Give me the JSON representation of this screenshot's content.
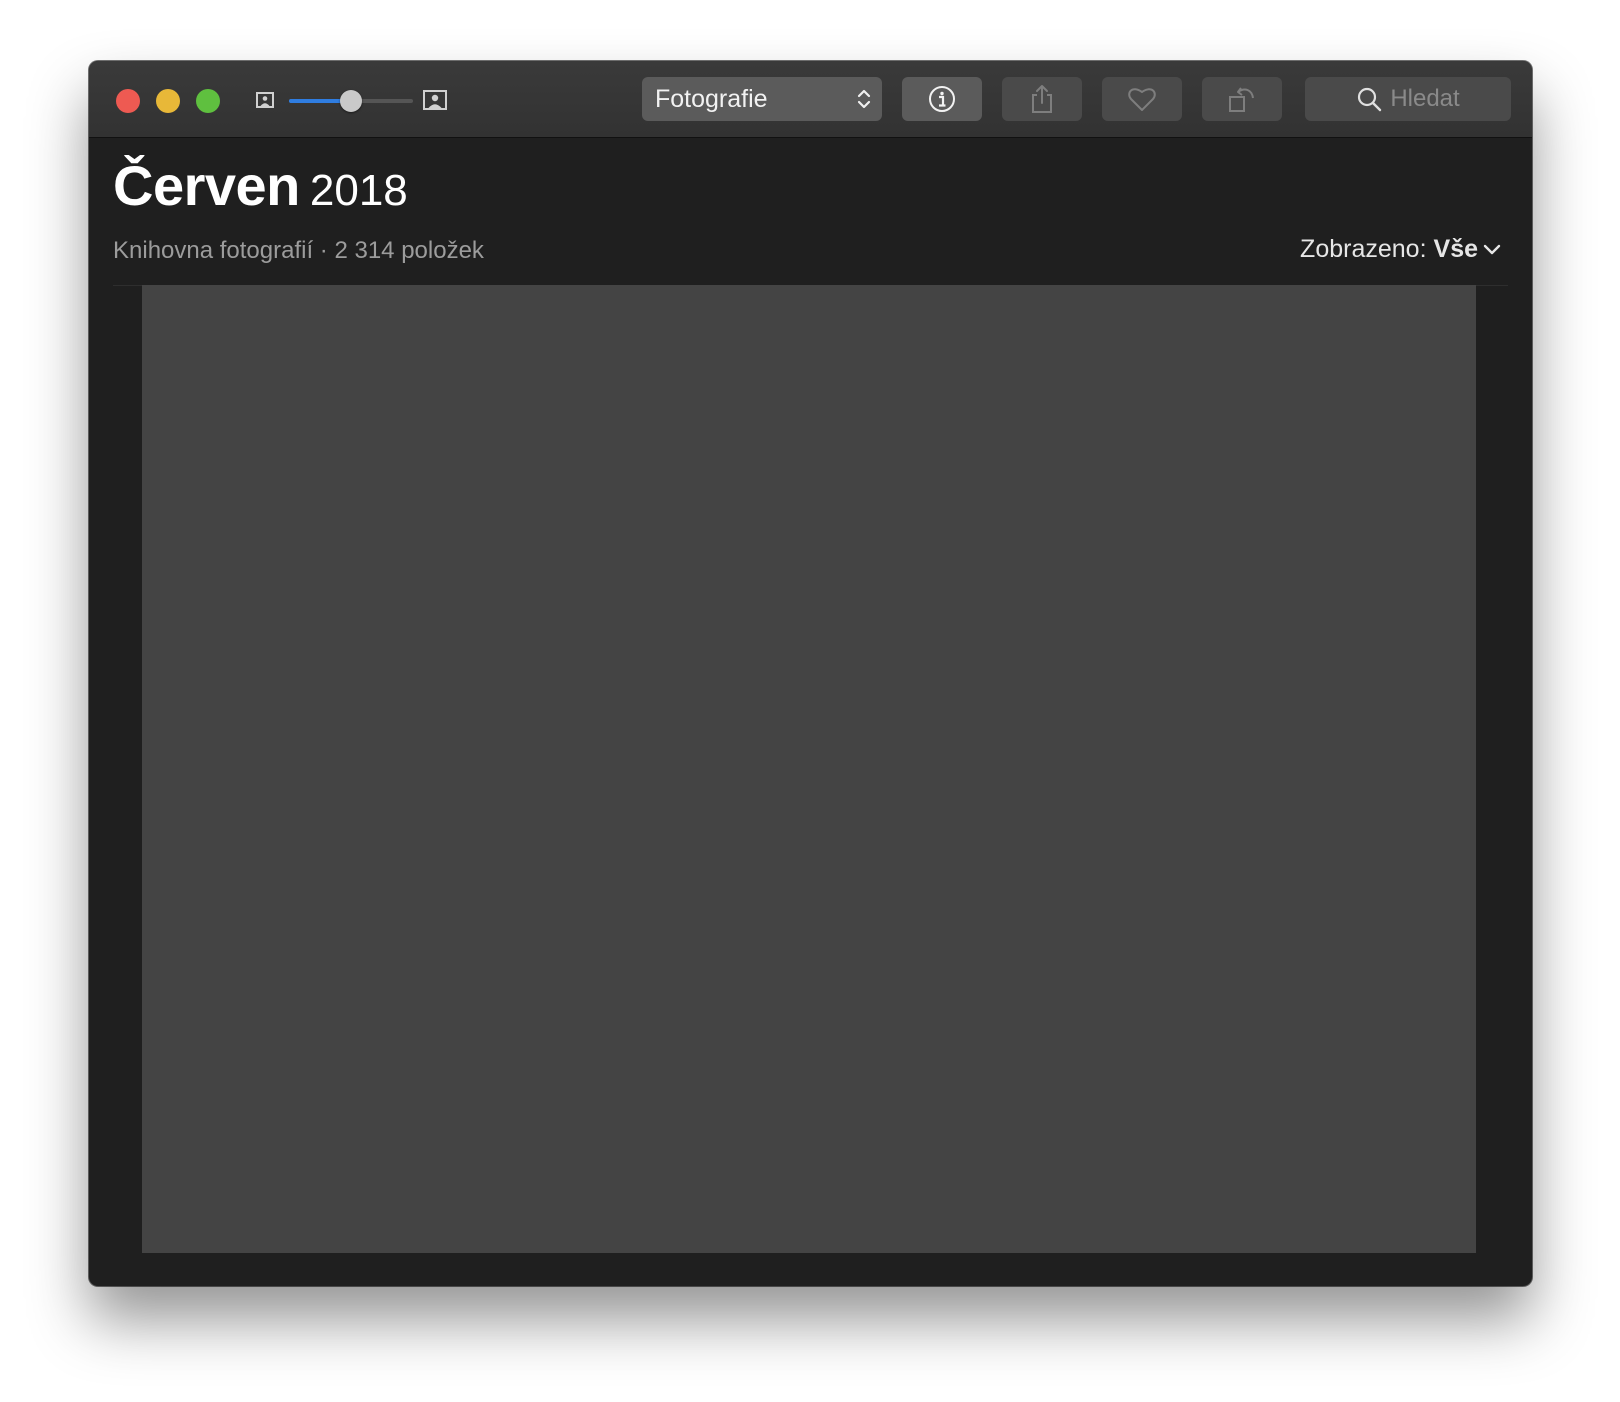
{
  "window": {
    "view_selector": {
      "selected": "Fotografie"
    },
    "toolbar": {
      "buttons": [
        {
          "name": "info",
          "icon": "info-icon",
          "enabled": true
        },
        {
          "name": "share",
          "icon": "share-icon",
          "enabled": false
        },
        {
          "name": "favorite",
          "icon": "heart-icon",
          "enabled": false
        },
        {
          "name": "rotate",
          "icon": "rotate-icon",
          "enabled": false
        }
      ],
      "zoom_slider_level": 0.5,
      "search": {
        "placeholder": "Hledat",
        "icon": "search-icon"
      }
    }
  },
  "main": {
    "title_month": "Červen",
    "title_year": "2018",
    "subtitle": "Knihovna fotografií · 2 314 položek",
    "filter": {
      "label": "Zobrazeno:",
      "value": "Vše"
    }
  },
  "colors": {
    "window_bg": "#1f1f1f",
    "accent": "#2f7de1",
    "close": "#ee5a52",
    "minimize": "#e8b838",
    "maximize": "#5fc03f",
    "photo_placeholder": "#444444"
  }
}
